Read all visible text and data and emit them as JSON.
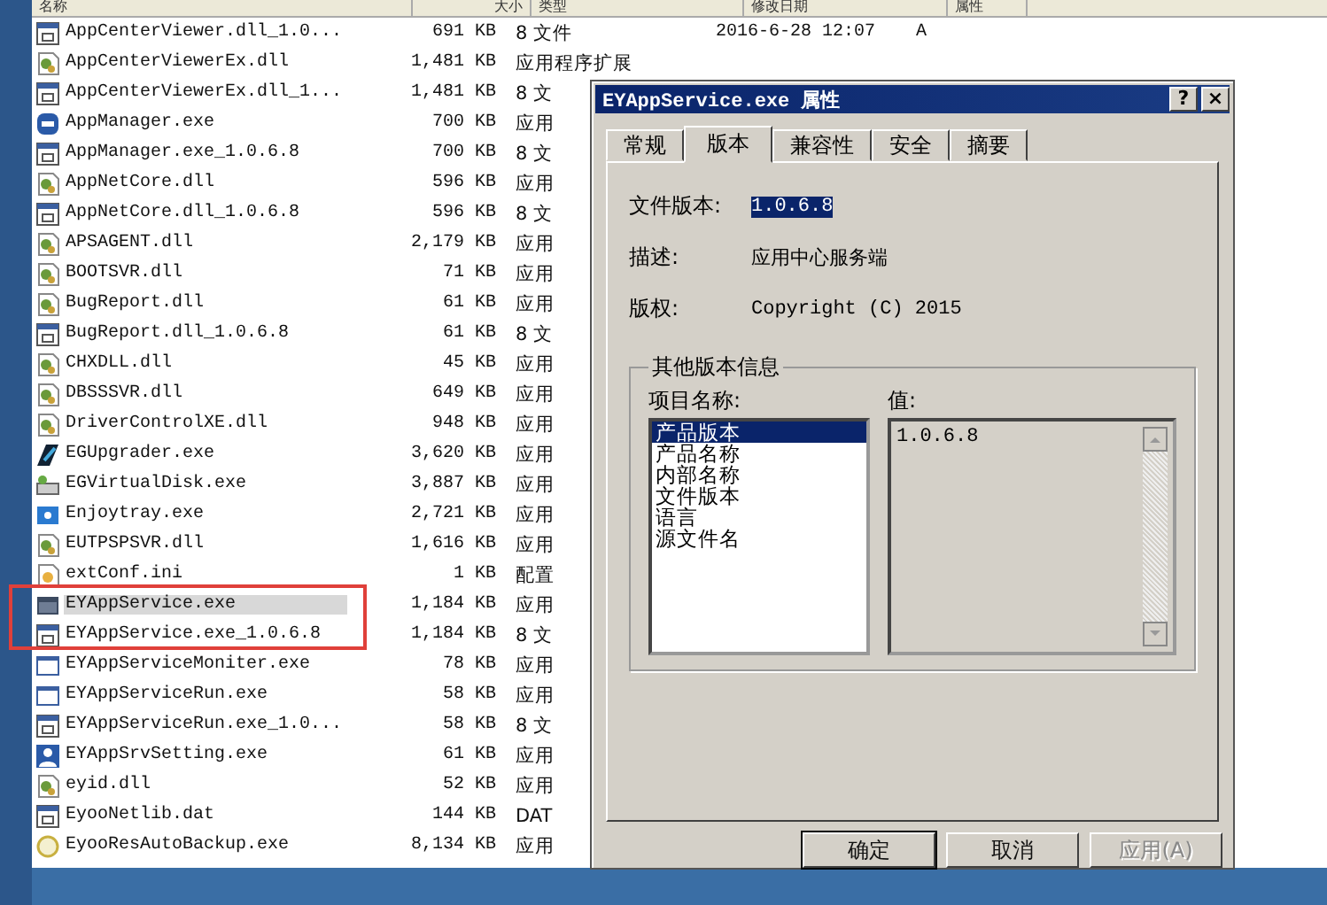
{
  "explorer": {
    "columns": [
      "名称",
      "大小",
      "类型",
      "修改日期",
      "属性"
    ],
    "rows": [
      {
        "kind": "file",
        "name": "AppCenterViewer.dll_1.0...",
        "size": "691 KB",
        "type": "8 文件",
        "date": "2016-6-28 12:07",
        "attr": "A",
        "selected": false
      },
      {
        "kind": "dll",
        "name": "AppCenterViewerEx.dll",
        "size": "1,481 KB",
        "type": "应用程序扩展",
        "selected": false
      },
      {
        "kind": "file",
        "name": "AppCenterViewerEx.dll_1...",
        "size": "1,481 KB",
        "type": "8 文",
        "selected": false
      },
      {
        "kind": "app",
        "name": "AppManager.exe",
        "size": "700 KB",
        "type": "应用",
        "selected": false
      },
      {
        "kind": "file",
        "name": "AppManager.exe_1.0.6.8",
        "size": "700 KB",
        "type": "8 文",
        "selected": false
      },
      {
        "kind": "dll",
        "name": "AppNetCore.dll",
        "size": "596 KB",
        "type": "应用",
        "selected": false
      },
      {
        "kind": "file",
        "name": "AppNetCore.dll_1.0.6.8",
        "size": "596 KB",
        "type": "8 文",
        "selected": false
      },
      {
        "kind": "dll",
        "name": "APSAGENT.dll",
        "size": "2,179 KB",
        "type": "应用",
        "selected": false
      },
      {
        "kind": "dll",
        "name": "BOOTSVR.dll",
        "size": "71 KB",
        "type": "应用",
        "selected": false
      },
      {
        "kind": "dll",
        "name": "BugReport.dll",
        "size": "61 KB",
        "type": "应用",
        "selected": false
      },
      {
        "kind": "file",
        "name": "BugReport.dll_1.0.6.8",
        "size": "61 KB",
        "type": "8 文",
        "selected": false
      },
      {
        "kind": "dll",
        "name": "CHXDLL.dll",
        "size": "45 KB",
        "type": "应用",
        "selected": false
      },
      {
        "kind": "dll",
        "name": "DBSSSVR.dll",
        "size": "649 KB",
        "type": "应用",
        "selected": false
      },
      {
        "kind": "dll",
        "name": "DriverControlXE.dll",
        "size": "948 KB",
        "type": "应用",
        "selected": false
      },
      {
        "kind": "upgrader",
        "name": "EGUpgrader.exe",
        "size": "3,620 KB",
        "type": "应用",
        "selected": false
      },
      {
        "kind": "disk",
        "name": "EGVirtualDisk.exe",
        "size": "3,887 KB",
        "type": "应用",
        "selected": false
      },
      {
        "kind": "tray",
        "name": "Enjoytray.exe",
        "size": "2,721 KB",
        "type": "应用",
        "selected": false
      },
      {
        "kind": "dll",
        "name": "EUTPSPSVR.dll",
        "size": "1,616 KB",
        "type": "应用",
        "selected": false
      },
      {
        "kind": "ini",
        "name": "extConf.ini",
        "size": "1 KB",
        "type": "配置",
        "selected": false
      },
      {
        "kind": "window",
        "name": "EYAppService.exe",
        "size": "1,184 KB",
        "type": "应用",
        "selected": true
      },
      {
        "kind": "file",
        "name": "EYAppService.exe_1.0.6.8",
        "size": "1,184 KB",
        "type": "8 文",
        "selected": false
      },
      {
        "kind": "blank",
        "name": "EYAppServiceMoniter.exe",
        "size": "78 KB",
        "type": "应用",
        "selected": false
      },
      {
        "kind": "blank",
        "name": "EYAppServiceRun.exe",
        "size": "58 KB",
        "type": "应用",
        "selected": false
      },
      {
        "kind": "file",
        "name": "EYAppServiceRun.exe_1.0...",
        "size": "58 KB",
        "type": "8 文",
        "selected": false
      },
      {
        "kind": "person",
        "name": "EYAppSrvSetting.exe",
        "size": "61 KB",
        "type": "应用",
        "selected": false
      },
      {
        "kind": "dll",
        "name": "eyid.dll",
        "size": "52 KB",
        "type": "应用",
        "selected": false
      },
      {
        "kind": "file",
        "name": "EyooNetlib.dat",
        "size": "144 KB",
        "type": "DAT",
        "selected": false
      },
      {
        "kind": "backup",
        "name": "EyooResAutoBackup.exe",
        "size": "8,134 KB",
        "type": "应用",
        "selected": false
      }
    ]
  },
  "dialog": {
    "title": "EYAppService.exe 属性",
    "title_buttons": [
      "?",
      "×"
    ],
    "tabs": [
      {
        "label": "常规",
        "selected": false
      },
      {
        "label": "版本",
        "selected": true
      },
      {
        "label": "兼容性",
        "selected": false
      },
      {
        "label": "安全",
        "selected": false
      },
      {
        "label": "摘要",
        "selected": false
      }
    ],
    "fields": [
      {
        "label": "文件版本:",
        "value": "1.0.6.8",
        "selected": true
      },
      {
        "label": "描述:",
        "value": "应用中心服务端",
        "selected": false
      },
      {
        "label": "版权:",
        "value": "Copyright (C) 2015",
        "selected": false
      }
    ],
    "group": {
      "title": "其他版本信息",
      "list_label": "项目名称:",
      "value_label": "值:",
      "items": [
        {
          "label": "产品版本",
          "selected": true
        },
        {
          "label": "产品名称",
          "selected": false
        },
        {
          "label": "内部名称",
          "selected": false
        },
        {
          "label": "文件版本",
          "selected": false
        },
        {
          "label": "语言",
          "selected": false
        },
        {
          "label": "源文件名",
          "selected": false
        }
      ],
      "value": "1.0.6.8"
    },
    "buttons": [
      {
        "label": "确定",
        "disabled": false,
        "default": true
      },
      {
        "label": "取消",
        "disabled": false,
        "default": false
      },
      {
        "label": "应用(A)",
        "disabled": true,
        "default": false
      }
    ]
  }
}
